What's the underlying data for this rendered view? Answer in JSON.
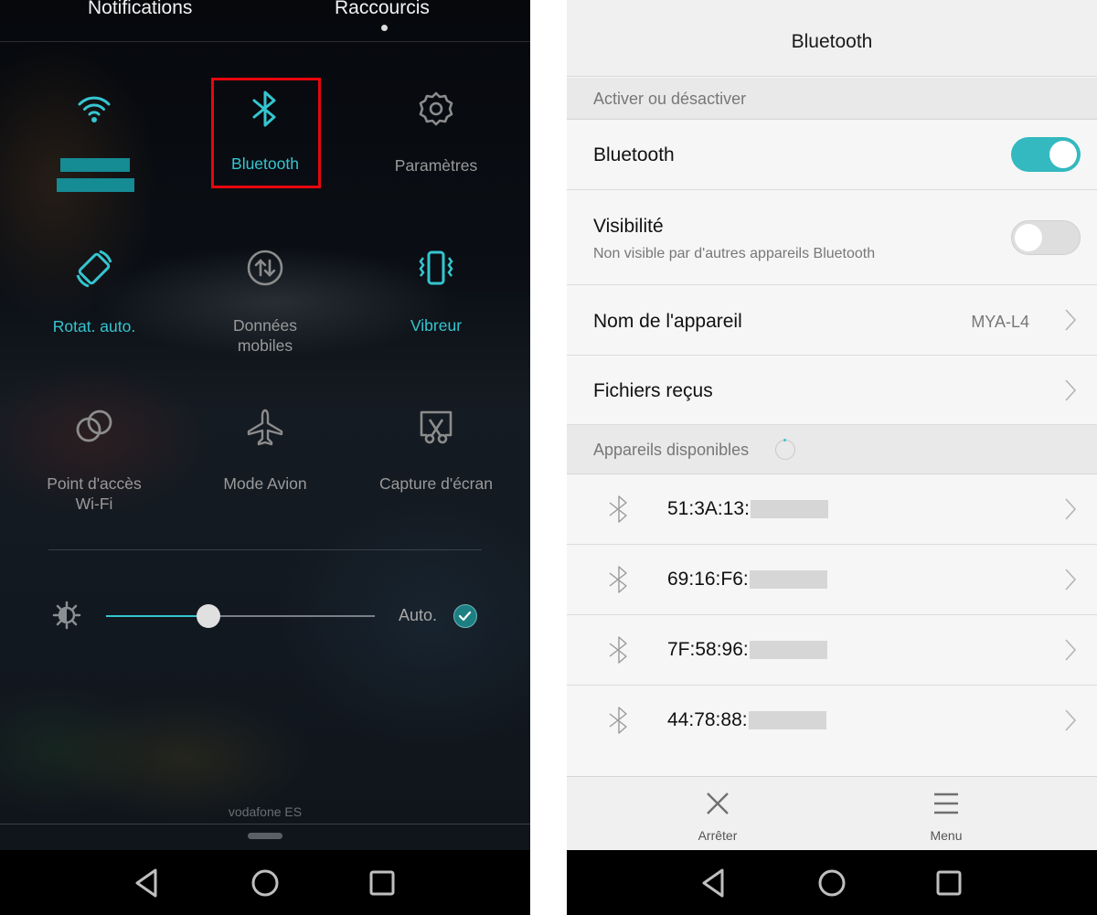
{
  "left_panel": {
    "tabs": [
      {
        "label": "Notifications",
        "active": false
      },
      {
        "label": "Raccourcis",
        "active": true
      }
    ],
    "tiles": [
      {
        "id": "wifi",
        "label": "",
        "icon": "wifi-icon",
        "active": true
      },
      {
        "id": "bluetooth",
        "label": "Bluetooth",
        "icon": "bluetooth-icon",
        "active": true,
        "highlighted": true
      },
      {
        "id": "settings",
        "label": "Paramètres",
        "icon": "gear-icon",
        "active": false
      },
      {
        "id": "rotation",
        "label": "Rotat. auto.",
        "icon": "rotate-icon",
        "active": true
      },
      {
        "id": "mobile-data",
        "label": "Données mobiles",
        "label_line1": "Données",
        "label_line2": "mobiles",
        "icon": "data-arrows-icon",
        "active": false
      },
      {
        "id": "vibrate",
        "label": "Vibreur",
        "icon": "vibrate-icon",
        "active": true
      },
      {
        "id": "hotspot",
        "label": "Point d'accès Wi-Fi",
        "label_line1": "Point d'accès",
        "label_line2": "Wi-Fi",
        "icon": "hotspot-icon",
        "active": false
      },
      {
        "id": "airplane",
        "label": "Mode Avion",
        "icon": "airplane-icon",
        "active": false
      },
      {
        "id": "screenshot",
        "label": "Capture d'écran",
        "icon": "screenshot-icon",
        "active": false
      }
    ],
    "brightness": {
      "level_percent": 38,
      "auto_label": "Auto.",
      "auto_checked": true
    },
    "carrier": "vodafone ES",
    "accent_color": "#35c5d0",
    "highlight_color": "#e8060d"
  },
  "right_panel": {
    "title": "Bluetooth",
    "section_toggle": "Activer ou désactiver",
    "bluetooth_row": {
      "label": "Bluetooth",
      "enabled": true
    },
    "visibility_row": {
      "label": "Visibilité",
      "sublabel": "Non visible par d'autres appareils Bluetooth",
      "enabled": false
    },
    "device_name_row": {
      "label": "Nom de l'appareil",
      "value": "MYA-L4"
    },
    "received_files_row": {
      "label": "Fichiers reçus"
    },
    "section_available": "Appareils disponibles",
    "devices": [
      {
        "mac_prefix": "51:3A:13:"
      },
      {
        "mac_prefix": "69:16:F6:"
      },
      {
        "mac_prefix": "7F:58:96:"
      },
      {
        "mac_prefix": "44:78:88:"
      }
    ],
    "bottom_actions": [
      {
        "label": "Arrêter",
        "icon": "close-icon"
      },
      {
        "label": "Menu",
        "icon": "menu-icon"
      }
    ],
    "accent_color": "#33b9bf"
  },
  "navbar": {
    "buttons": [
      "back",
      "home",
      "recents"
    ]
  }
}
